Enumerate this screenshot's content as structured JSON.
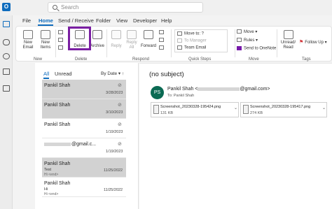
{
  "titlebar": {
    "app_icon_letter": "O",
    "search_placeholder": "Search"
  },
  "menu": {
    "items": [
      "File",
      "Home",
      "Send / Receive",
      "Folder",
      "View",
      "Developer",
      "Help"
    ],
    "active": "Home"
  },
  "ribbon": {
    "new_group": {
      "label": "New",
      "new_email": [
        "New",
        "Email"
      ],
      "new_items": [
        "New",
        "Items"
      ]
    },
    "delete_group": {
      "label": "Delete",
      "delete": "Delete",
      "archive": "Archive"
    },
    "respond_group": {
      "label": "Respond",
      "reply": "Reply",
      "reply_all": [
        "Reply",
        "All"
      ],
      "forward": "Forward"
    },
    "quick_steps": {
      "label": "Quick Steps",
      "items": [
        "Move to: ?",
        "To Manager",
        "Team Email"
      ]
    },
    "move_group": {
      "label": "Move",
      "move": "Move",
      "rules": "Rules",
      "onenote": "Send to OneNote"
    },
    "tags_group": {
      "label": "Tags",
      "unread_read": [
        "Unread/",
        "Read"
      ],
      "follow_up": "Follow Up"
    }
  },
  "maillist": {
    "filter_all": "All",
    "filter_unread": "Unread",
    "sort": "By Date",
    "rows": [
      {
        "from": "Pankil Shah",
        "date": "3/28/2023",
        "subject": "",
        "preview": "",
        "selected": true,
        "attachment": true,
        "redacted": false
      },
      {
        "from": "Pankil Shah",
        "date": "3/10/2023",
        "subject": "",
        "preview": "",
        "selected": true,
        "attachment": true,
        "redacted": false
      },
      {
        "from": "Pankil Shah",
        "date": "1/19/2023",
        "subject": "",
        "preview": "",
        "selected": false,
        "attachment": true,
        "redacted": false
      },
      {
        "from": "@gmail.c...",
        "date": "1/19/2023",
        "subject": "",
        "preview": "",
        "selected": false,
        "attachment": true,
        "redacted": true
      },
      {
        "from": "Pankil Shah",
        "date": "11/25/2022",
        "subject": "Test",
        "preview": "Hi <end>",
        "selected": true,
        "attachment": false,
        "redacted": false
      },
      {
        "from": "Pankil Shah",
        "date": "11/25/2022",
        "subject": "Hi",
        "preview": "Hi <end>",
        "selected": false,
        "attachment": false,
        "redacted": false
      }
    ]
  },
  "reading": {
    "subject": "(no subject)",
    "avatar_initials": "PS",
    "sender_name": "Pankil Shah <",
    "sender_domain": "@gmail.com>",
    "to_label": "To:",
    "to_name": "Pankil Shah",
    "attachments": [
      {
        "name": "Screenshot_20230328-195424.png",
        "size": "131 KB"
      },
      {
        "name": "Screenshot_20230328-195417.png",
        "size": "274 KB"
      }
    ]
  },
  "colors": {
    "accent": "#0f6cbd",
    "delete_highlight": "#7a1fa2",
    "avatar_bg": "#0b6a53",
    "selected_row": "#d2d2d2"
  }
}
